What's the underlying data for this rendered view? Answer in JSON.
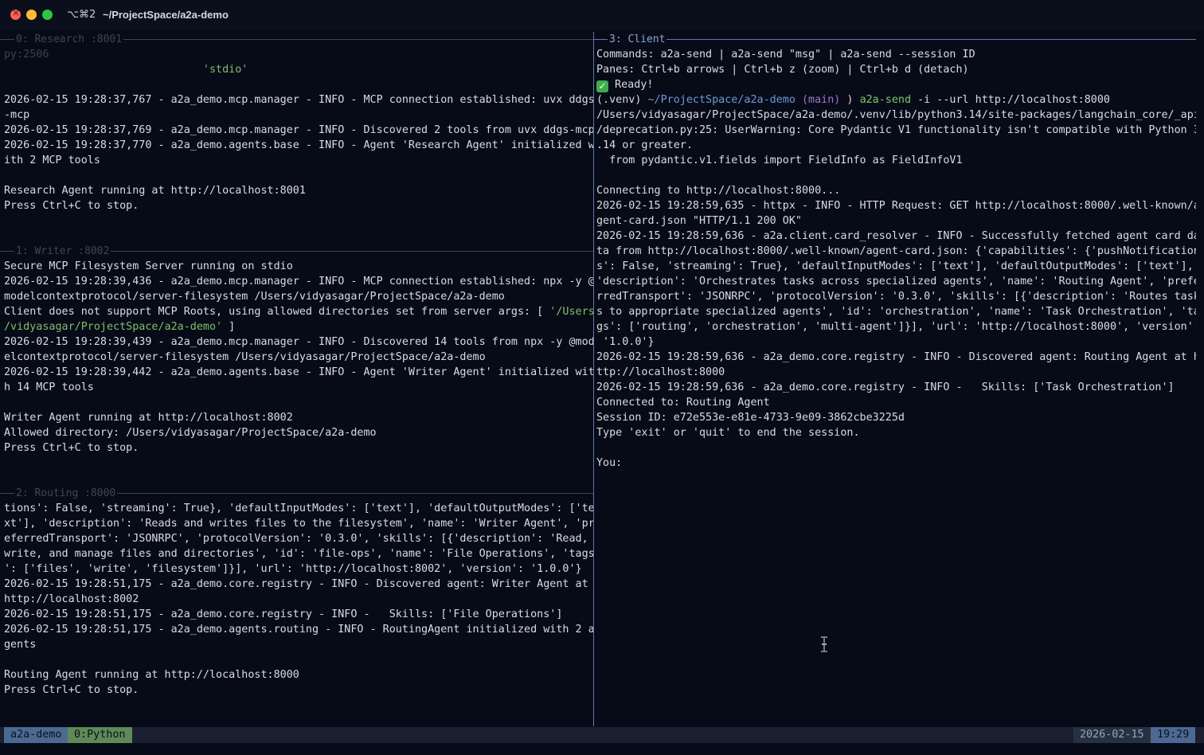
{
  "window": {
    "shortcut": "⌥⌘2",
    "title": "~/ProjectSpace/a2a-demo"
  },
  "panes": {
    "research": {
      "label": "0: Research :8001",
      "lines": [
        [
          {
            "t": "py:2506",
            "c": "dim"
          }
        ],
        [
          {
            "t": "                               "
          },
          {
            "t": "'stdio'",
            "c": "g"
          }
        ],
        [
          {
            "t": ""
          }
        ],
        [
          {
            "t": "2026-02-15 19:28:37,767 - a2a_demo.mcp.manager - INFO - MCP connection established: uvx ddgs"
          }
        ],
        [
          {
            "t": "-mcp"
          }
        ],
        [
          {
            "t": "2026-02-15 19:28:37,769 - a2a_demo.mcp.manager - INFO - Discovered 2 tools from uvx ddgs-mcp"
          }
        ],
        [
          {
            "t": "2026-02-15 19:28:37,770 - a2a_demo.agents.base - INFO - Agent 'Research Agent' initialized w"
          }
        ],
        [
          {
            "t": "ith 2 MCP tools"
          }
        ],
        [
          {
            "t": ""
          }
        ],
        [
          {
            "t": "Research Agent running at http://localhost:8001"
          }
        ],
        [
          {
            "t": "Press Ctrl+C to stop."
          }
        ]
      ]
    },
    "writer": {
      "label": "1: Writer :8002",
      "lines": [
        [
          {
            "t": "Secure MCP Filesystem Server running on stdio"
          }
        ],
        [
          {
            "t": "2026-02-15 19:28:39,436 - a2a_demo.mcp.manager - INFO - MCP connection established: npx -y @"
          }
        ],
        [
          {
            "t": "modelcontextprotocol/server-filesystem /Users/vidyasagar/ProjectSpace/a2a-demo"
          }
        ],
        [
          {
            "t": "Client does not support MCP Roots, using allowed directories set from server args: [ "
          },
          {
            "t": "'/Users",
            "c": "g"
          }
        ],
        [
          {
            "t": "/vidyasagar/ProjectSpace/a2a-demo'",
            "c": "g"
          },
          {
            "t": " ]"
          }
        ],
        [
          {
            "t": "2026-02-15 19:28:39,439 - a2a_demo.mcp.manager - INFO - Discovered 14 tools from npx -y @mod"
          }
        ],
        [
          {
            "t": "elcontextprotocol/server-filesystem /Users/vidyasagar/ProjectSpace/a2a-demo"
          }
        ],
        [
          {
            "t": "2026-02-15 19:28:39,442 - a2a_demo.agents.base - INFO - Agent 'Writer Agent' initialized wit"
          }
        ],
        [
          {
            "t": "h 14 MCP tools"
          }
        ],
        [
          {
            "t": ""
          }
        ],
        [
          {
            "t": "Writer Agent running at http://localhost:8002"
          }
        ],
        [
          {
            "t": "Allowed directory: /Users/vidyasagar/ProjectSpace/a2a-demo"
          }
        ],
        [
          {
            "t": "Press Ctrl+C to stop."
          }
        ]
      ]
    },
    "routing": {
      "label": "2: Routing :8000",
      "lines": [
        [
          {
            "t": "tions': False, 'streaming': True}, 'defaultInputModes': ['text'], 'defaultOutputModes': ['te"
          }
        ],
        [
          {
            "t": "xt'], 'description': 'Reads and writes files to the filesystem', 'name': 'Writer Agent', 'pr"
          }
        ],
        [
          {
            "t": "eferredTransport': 'JSONRPC', 'protocolVersion': '0.3.0', 'skills': [{'description': 'Read,"
          }
        ],
        [
          {
            "t": "write, and manage files and directories', 'id': 'file-ops', 'name': 'File Operations', 'tags"
          }
        ],
        [
          {
            "t": "': ['files', 'write', 'filesystem']}], 'url': 'http://localhost:8002', 'version': '1.0.0'}"
          }
        ],
        [
          {
            "t": "2026-02-15 19:28:51,175 - a2a_demo.core.registry - INFO - Discovered agent: Writer Agent at"
          }
        ],
        [
          {
            "t": "http://localhost:8002"
          }
        ],
        [
          {
            "t": "2026-02-15 19:28:51,175 - a2a_demo.core.registry - INFO -   Skills: ['File Operations']"
          }
        ],
        [
          {
            "t": "2026-02-15 19:28:51,175 - a2a_demo.agents.routing - INFO - RoutingAgent initialized with 2 a"
          }
        ],
        [
          {
            "t": "gents"
          }
        ],
        [
          {
            "t": ""
          }
        ],
        [
          {
            "t": "Routing Agent running at http://localhost:8000"
          }
        ],
        [
          {
            "t": "Press Ctrl+C to stop."
          }
        ]
      ]
    },
    "client": {
      "label": "3: Client",
      "lines": [
        [
          {
            "t": "Commands: a2a-send | a2a-send \"msg\" | a2a-send --session ID"
          }
        ],
        [
          {
            "t": "Panes: Ctrl+b arrows | Ctrl+b z (zoom) | Ctrl+b d (detach)"
          }
        ],
        [
          {
            "t": "✓",
            "c": "emoji"
          },
          {
            "t": " Ready!"
          }
        ],
        [
          {
            "t": "(.venv) "
          },
          {
            "t": "~/ProjectSpace/a2a-demo",
            "c": "blue"
          },
          {
            "t": " (main)",
            "c": "pink"
          },
          {
            "t": " ) "
          },
          {
            "t": "a2a-send",
            "c": "green2"
          },
          {
            "t": " -i --url http://localhost:8000"
          }
        ],
        [
          {
            "t": "/Users/vidyasagar/ProjectSpace/a2a-demo/.venv/lib/python3.14/site-packages/langchain_core/_api"
          }
        ],
        [
          {
            "t": "/deprecation.py:25: UserWarning: Core Pydantic V1 functionality isn't compatible with Python 3"
          }
        ],
        [
          {
            "t": ".14 or greater."
          }
        ],
        [
          {
            "t": "  from pydantic.v1.fields import FieldInfo as FieldInfoV1"
          }
        ],
        [
          {
            "t": ""
          }
        ],
        [
          {
            "t": "Connecting to http://localhost:8000..."
          }
        ],
        [
          {
            "t": "2026-02-15 19:28:59,635 - httpx - INFO - HTTP Request: GET http://localhost:8000/.well-known/a"
          }
        ],
        [
          {
            "t": "gent-card.json \"HTTP/1.1 200 OK\""
          }
        ],
        [
          {
            "t": "2026-02-15 19:28:59,636 - a2a.client.card_resolver - INFO - Successfully fetched agent card da"
          }
        ],
        [
          {
            "t": "ta from http://localhost:8000/.well-known/agent-card.json: {'capabilities': {'pushNotification"
          }
        ],
        [
          {
            "t": "s': False, 'streaming': True}, 'defaultInputModes': ['text'], 'defaultOutputModes': ['text'],"
          }
        ],
        [
          {
            "t": "'description': 'Orchestrates tasks across specialized agents', 'name': 'Routing Agent', 'prefe"
          }
        ],
        [
          {
            "t": "rredTransport': 'JSONRPC', 'protocolVersion': '0.3.0', 'skills': [{'description': 'Routes task"
          }
        ],
        [
          {
            "t": "s to appropriate specialized agents', 'id': 'orchestration', 'name': 'Task Orchestration', 'ta"
          }
        ],
        [
          {
            "t": "gs': ['routing', 'orchestration', 'multi-agent']}], 'url': 'http://localhost:8000', 'version':"
          }
        ],
        [
          {
            "t": " '1.0.0'}"
          }
        ],
        [
          {
            "t": "2026-02-15 19:28:59,636 - a2a_demo.core.registry - INFO - Discovered agent: Routing Agent at h"
          }
        ],
        [
          {
            "t": "ttp://localhost:8000"
          }
        ],
        [
          {
            "t": "2026-02-15 19:28:59,636 - a2a_demo.core.registry - INFO -   Skills: ['Task Orchestration']"
          }
        ],
        [
          {
            "t": "Connected to: Routing Agent"
          }
        ],
        [
          {
            "t": "Session ID: e72e553e-e81e-4733-9e09-3862cbe3225d"
          }
        ],
        [
          {
            "t": "Type 'exit' or 'quit' to end the session."
          }
        ],
        [
          {
            "t": ""
          }
        ],
        [
          {
            "t": "You:"
          }
        ]
      ]
    }
  },
  "statusbar": {
    "session": "a2a-demo",
    "window": "0:Python",
    "date": "2026-02-15",
    "time": "19:29"
  }
}
